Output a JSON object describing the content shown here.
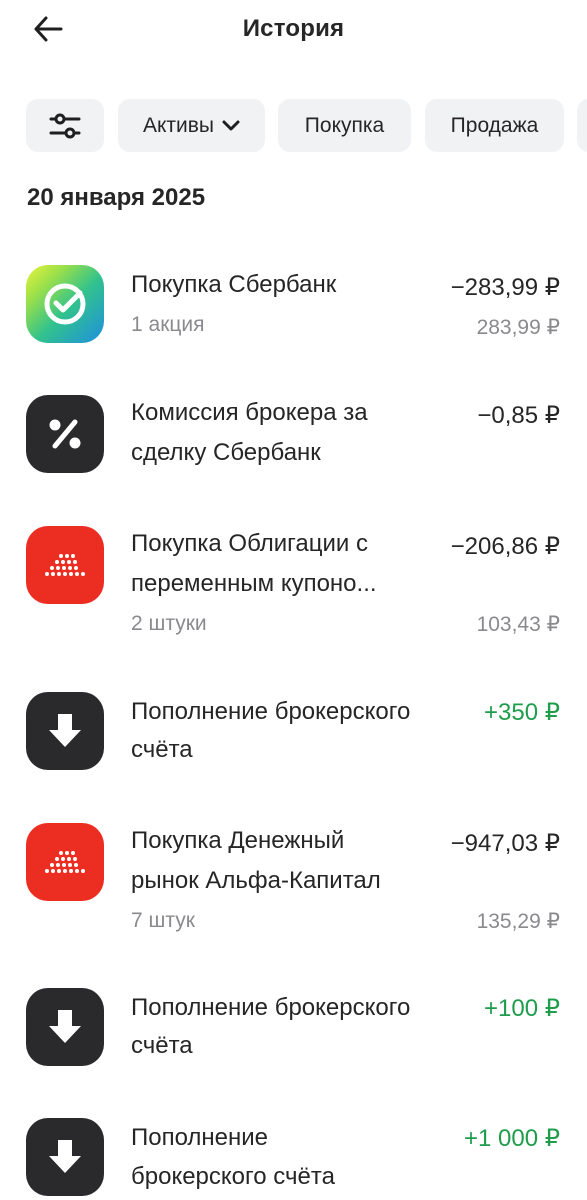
{
  "header": {
    "title": "История",
    "back_icon": "arrow-left-icon"
  },
  "filters": {
    "settings_icon": "sliders-icon",
    "assets_label": "Активы",
    "buy_label": "Покупка",
    "sell_label": "Продажа"
  },
  "date_heading": "20 января 2025",
  "colors": {
    "positive": "#1f9d4c",
    "secondary": "#8a8a8e",
    "red_tile": "#eb2d22",
    "dark_tile": "#2a2a2c"
  },
  "operations": [
    {
      "icon": "sber-logo-icon",
      "title_line1": "Покупка Сбербанк",
      "title_line2": "",
      "subtitle": "1 акция",
      "amount": "−283,99 ₽",
      "price": "283,99 ₽"
    },
    {
      "icon": "percent-icon",
      "title_line1": "Комиссия брокера за",
      "title_line2": "сделку Сбербанк",
      "subtitle": "",
      "amount": "−0,85 ₽",
      "price": ""
    },
    {
      "icon": "alfa-dots-icon",
      "title_line1": "Покупка Облигации с",
      "title_line2": "переменным купоно...",
      "subtitle": "2 штуки",
      "amount": "−206,86 ₽",
      "price": "103,43 ₽"
    },
    {
      "icon": "arrow-down-icon",
      "title_line1": "Пополнение брокерского",
      "title_line2": "счёта",
      "subtitle": "",
      "amount": "+350 ₽",
      "price": ""
    },
    {
      "icon": "alfa-dots-icon",
      "title_line1": "Покупка Денежный",
      "title_line2": "рынок Альфа-Капитал",
      "subtitle": "7 штук",
      "amount": "−947,03 ₽",
      "price": "135,29 ₽"
    },
    {
      "icon": "arrow-down-icon",
      "title_line1": "Пополнение брокерского",
      "title_line2": "счёта",
      "subtitle": "",
      "amount": "+100 ₽",
      "price": ""
    },
    {
      "icon": "arrow-down-icon",
      "title_line1": "Пополнение",
      "title_line2": "брокерского счёта",
      "subtitle": "",
      "amount": "+1 000 ₽",
      "price": ""
    }
  ]
}
